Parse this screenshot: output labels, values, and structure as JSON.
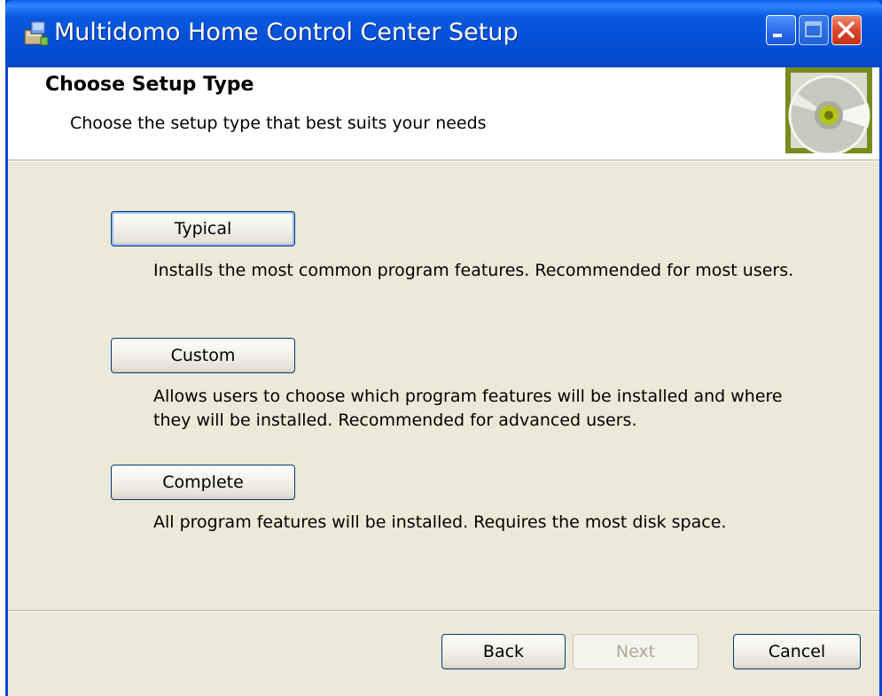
{
  "window": {
    "title": "Multidomo Home Control Center Setup",
    "title_icon": "installer-icon",
    "controls": [
      "minimize-icon",
      "maximize-icon",
      "close-icon"
    ]
  },
  "header": {
    "title": "Choose Setup Type",
    "subtitle": "Choose the setup type that best suits your needs",
    "banner_icon": "cd-disc-icon"
  },
  "options": {
    "typical": {
      "label": "Typical",
      "description": "Installs the most common program features. Recommended for most users."
    },
    "custom": {
      "label": "Custom",
      "description_line1": "Allows users to choose which program features will be installed and where",
      "description_line2": "they will be installed. Recommended for advanced users."
    },
    "complete": {
      "label": "Complete",
      "description": "All program features will be installed. Requires the most disk space."
    }
  },
  "footer": {
    "back_label": "Back",
    "next_label": "Next",
    "next_disabled": true,
    "cancel_label": "Cancel"
  },
  "colors": {
    "titlebar": "#0a50d8",
    "dialog_background": "#ece9d8",
    "header_background": "#ffffff",
    "banner_frame": "#7b8a1e",
    "disabled_text": "#aca899"
  }
}
